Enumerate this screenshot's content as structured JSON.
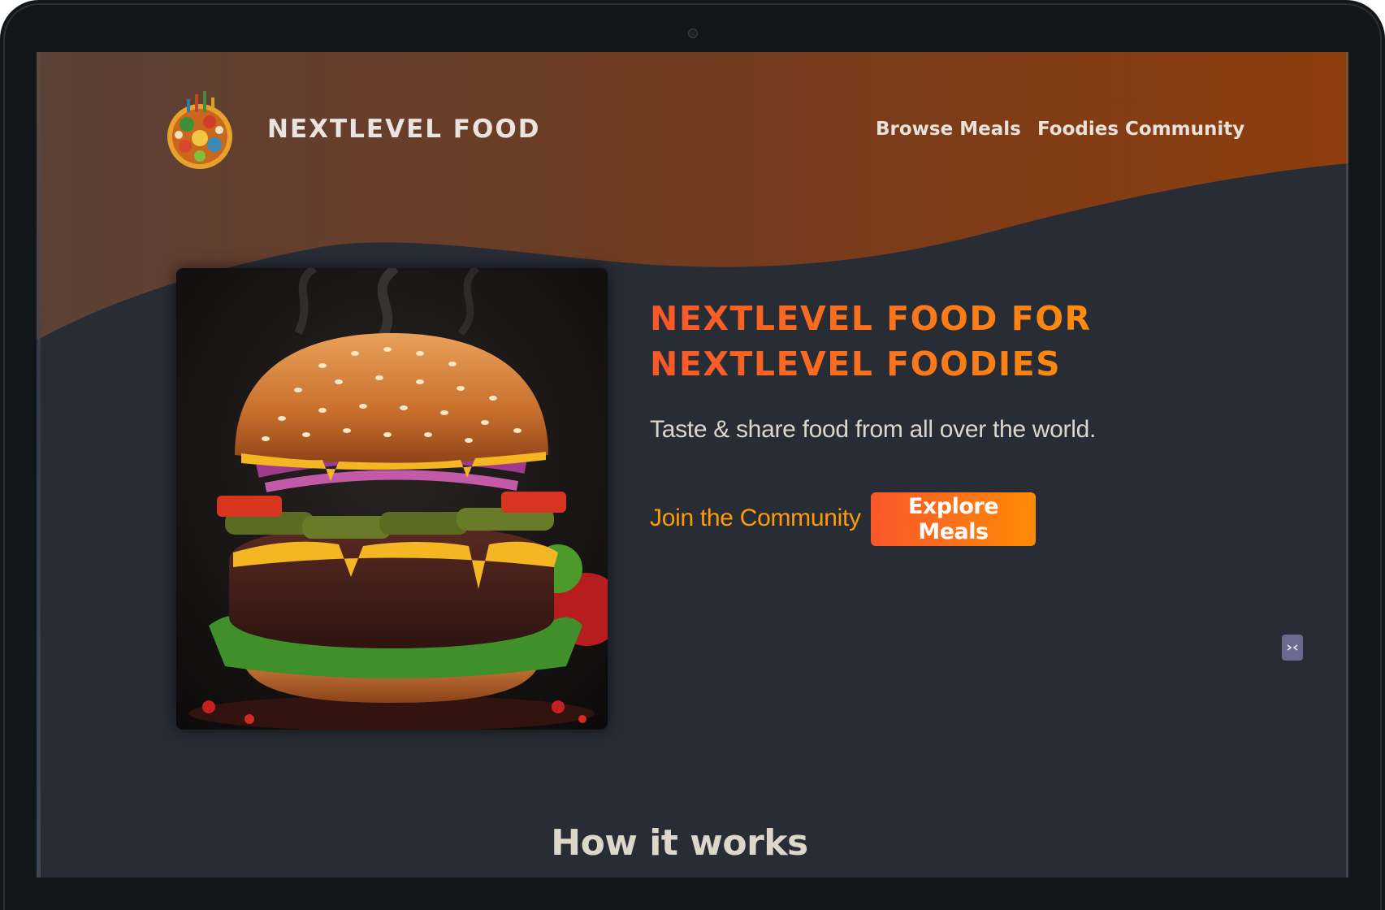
{
  "header": {
    "brand": "NEXTLEVEL FOOD",
    "logo_icon": "food-plate-logo",
    "nav": [
      {
        "label": "Browse Meals"
      },
      {
        "label": "Foodies Community"
      }
    ]
  },
  "hero": {
    "title_line1": "NEXTLEVEL FOOD FOR",
    "title_line2": "NEXTLEVEL FOODIES",
    "subtitle": "Taste & share food from all over the world.",
    "join_label": "Join the Community",
    "explore_label": "Explore Meals",
    "image_subject": "burger-photo"
  },
  "section": {
    "how_it_works": "How it works"
  },
  "colors": {
    "background": "#282c35",
    "accent_start": "#f9572a",
    "accent_end": "#ff9b05",
    "header_gradient_start": "#5b4136",
    "header_gradient_end": "#8e3d0d"
  },
  "icons": {
    "extension_badge": "extension-icon"
  }
}
